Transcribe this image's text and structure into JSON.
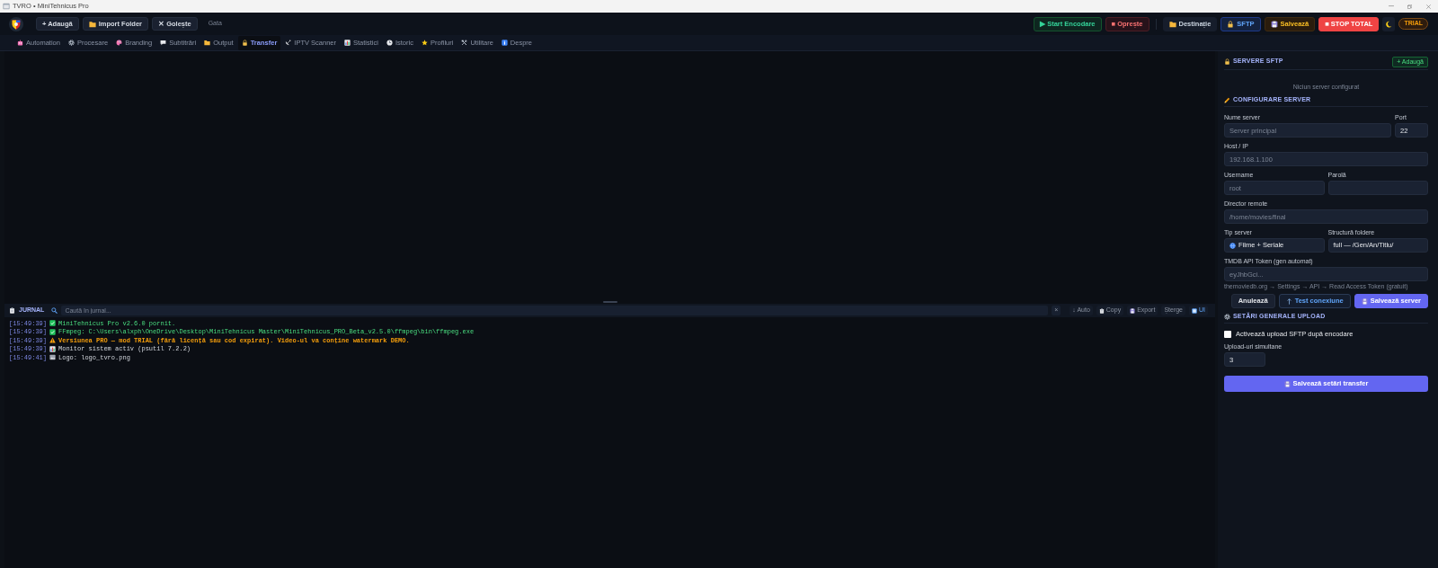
{
  "window": {
    "title": "TVRO • MiniTehnicus Pro"
  },
  "header": {
    "left_buttons": [
      {
        "label": "+ Adaugă"
      },
      {
        "label": "Import Folder"
      },
      {
        "label": "✕ Golește"
      }
    ],
    "status": "Gata",
    "right_buttons": [
      {
        "label": "▶ Start Encodare",
        "kind": "start"
      },
      {
        "label": "■ Oprește",
        "kind": "stop"
      },
      {
        "label": "Destinație",
        "kind": "neutral"
      },
      {
        "label": "SFTP",
        "kind": "active"
      },
      {
        "label": "Salvează",
        "kind": "save"
      },
      {
        "label": "■ STOP TOTAL",
        "kind": "danger"
      }
    ],
    "badge": "TRIAL"
  },
  "tabs": [
    {
      "label": "Automation",
      "selected": false
    },
    {
      "label": "Procesare",
      "selected": false
    },
    {
      "label": "Branding",
      "selected": false
    },
    {
      "label": "Subtitrări",
      "selected": false
    },
    {
      "label": "Output",
      "selected": false
    },
    {
      "label": "Transfer",
      "selected": true
    },
    {
      "label": "IPTV Scanner",
      "selected": false
    },
    {
      "label": "Statistici",
      "selected": false
    },
    {
      "label": "Istoric",
      "selected": false
    },
    {
      "label": "Profiluri",
      "selected": false
    },
    {
      "label": "Utilitare",
      "selected": false
    },
    {
      "label": "Despre",
      "selected": false
    }
  ],
  "sftp": {
    "servers_title": "SERVERE SFTP",
    "add_button": "+ Adaugă",
    "empty_text": "Niciun server configurat",
    "config_title": "CONFIGURARE SERVER",
    "rows": [
      [
        {
          "label": "Nume server",
          "kind": "text",
          "placeholder": "Server principal"
        },
        {
          "label": "Port",
          "kind": "number",
          "value": "22"
        }
      ],
      [
        {
          "label": "Host / IP",
          "kind": "text",
          "placeholder": "192.168.1.100"
        }
      ],
      [
        {
          "label": "Username",
          "kind": "text",
          "placeholder": "root"
        },
        {
          "label": "Parolă",
          "kind": "password"
        }
      ],
      [
        {
          "label": "Director remote",
          "kind": "text",
          "placeholder": "/home/movies/final"
        }
      ],
      [
        {
          "label": "Tip server",
          "kind": "select",
          "value": "Filme + Seriale"
        },
        {
          "label": "Structură foldere",
          "kind": "select",
          "value": "full — /Gen/An/Titlu/"
        }
      ],
      [
        {
          "label": "TMDB API Token (gen automat)",
          "kind": "text",
          "placeholder": "eyJhbGci...",
          "hint": "themoviedb.org → Settings → API → Read Access Token (gratuit)"
        }
      ]
    ],
    "buttons": [
      {
        "label": "Anulează",
        "kind": "secondary"
      },
      {
        "label": "Test conexiune",
        "kind": "outline"
      },
      {
        "label": "Salvează server",
        "kind": "primary"
      }
    ]
  },
  "upload": {
    "title": "SETĂRI GENERALE UPLOAD",
    "checkbox": {
      "label": "Activează upload SFTP după encodare",
      "checked": false
    },
    "concurrent": {
      "label": "Upload-uri simultane",
      "value": "3"
    },
    "save_button": "Salvează setări transfer"
  },
  "journal": {
    "title": "JURNAL",
    "search_placeholder": "Caută în jurnal...",
    "clear": "×",
    "actions": [
      {
        "label": "↓ Auto",
        "on": false
      },
      {
        "label": "Copy",
        "on": false
      },
      {
        "label": "Export",
        "on": false
      },
      {
        "label": "Șterge",
        "on": false
      },
      {
        "label": "UI",
        "on": true
      }
    ],
    "lines": [
      {
        "time": "[15:49:39]",
        "kind": "success",
        "text": "MiniTehnicus Pro v2.6.0 pornit."
      },
      {
        "time": "[15:49:39]",
        "kind": "success",
        "text": "FFmpeg: C:\\Users\\alxph\\OneDrive\\Desktop\\MiniTehnicus Master\\MiniTehnicus_PRO_Beta_v2.5.0\\ffmpeg\\bin\\ffmpeg.exe"
      },
      {
        "time": "[15:49:39]",
        "kind": "warning",
        "text": "Versiunea PRO — mod TRIAL (fără licență sau cod expirat). Video-ul va conține watermark DEMO."
      },
      {
        "time": "[15:49:39]",
        "kind": "info",
        "text": "Monitor sistem activ (psutil 7.2.2)"
      },
      {
        "time": "[15:49:41]",
        "kind": "info",
        "text": "Logo: logo_tvro.png"
      }
    ]
  }
}
